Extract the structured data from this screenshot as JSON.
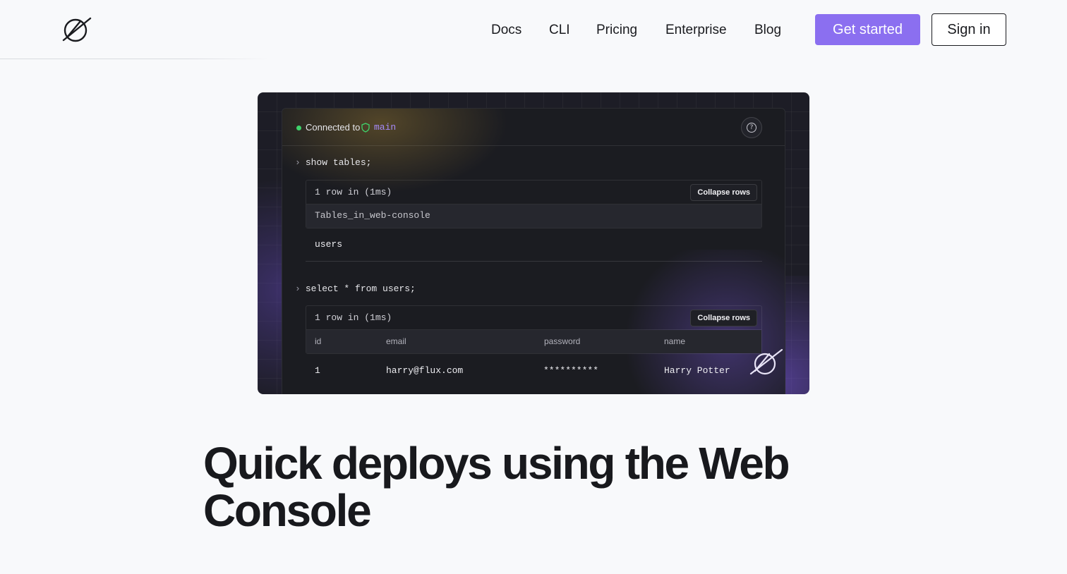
{
  "nav": {
    "links": [
      "Docs",
      "CLI",
      "Pricing",
      "Enterprise",
      "Blog"
    ],
    "get_started_label": "Get started",
    "sign_in_label": "Sign in"
  },
  "console": {
    "connected_text": "Connected to",
    "branch": "main",
    "queries": [
      {
        "command": "show tables;",
        "row_count": "1 row in (1ms)",
        "collapse_label": "Collapse rows",
        "columns": [
          "Tables_in_web-console"
        ],
        "rows": [
          [
            "users"
          ]
        ]
      },
      {
        "command": "select * from users;",
        "row_count": "1 row in (1ms)",
        "collapse_label": "Collapse rows",
        "columns": [
          "id",
          "email",
          "password",
          "name"
        ],
        "rows": [
          [
            "1",
            "harry@flux.com",
            "**********",
            "Harry Potter"
          ]
        ]
      }
    ]
  },
  "hero": {
    "headline": "Quick deploys using the Web Console"
  },
  "colors": {
    "accent": "#8b6ff0",
    "console_bg": "#1b1c21",
    "status_green": "#3fd36b",
    "branch_purple": "#a78bfa"
  },
  "icons": [
    "brand-logo-icon",
    "shield-icon",
    "help-icon",
    "chevron-right-icon",
    "brand-watermark-icon"
  ]
}
